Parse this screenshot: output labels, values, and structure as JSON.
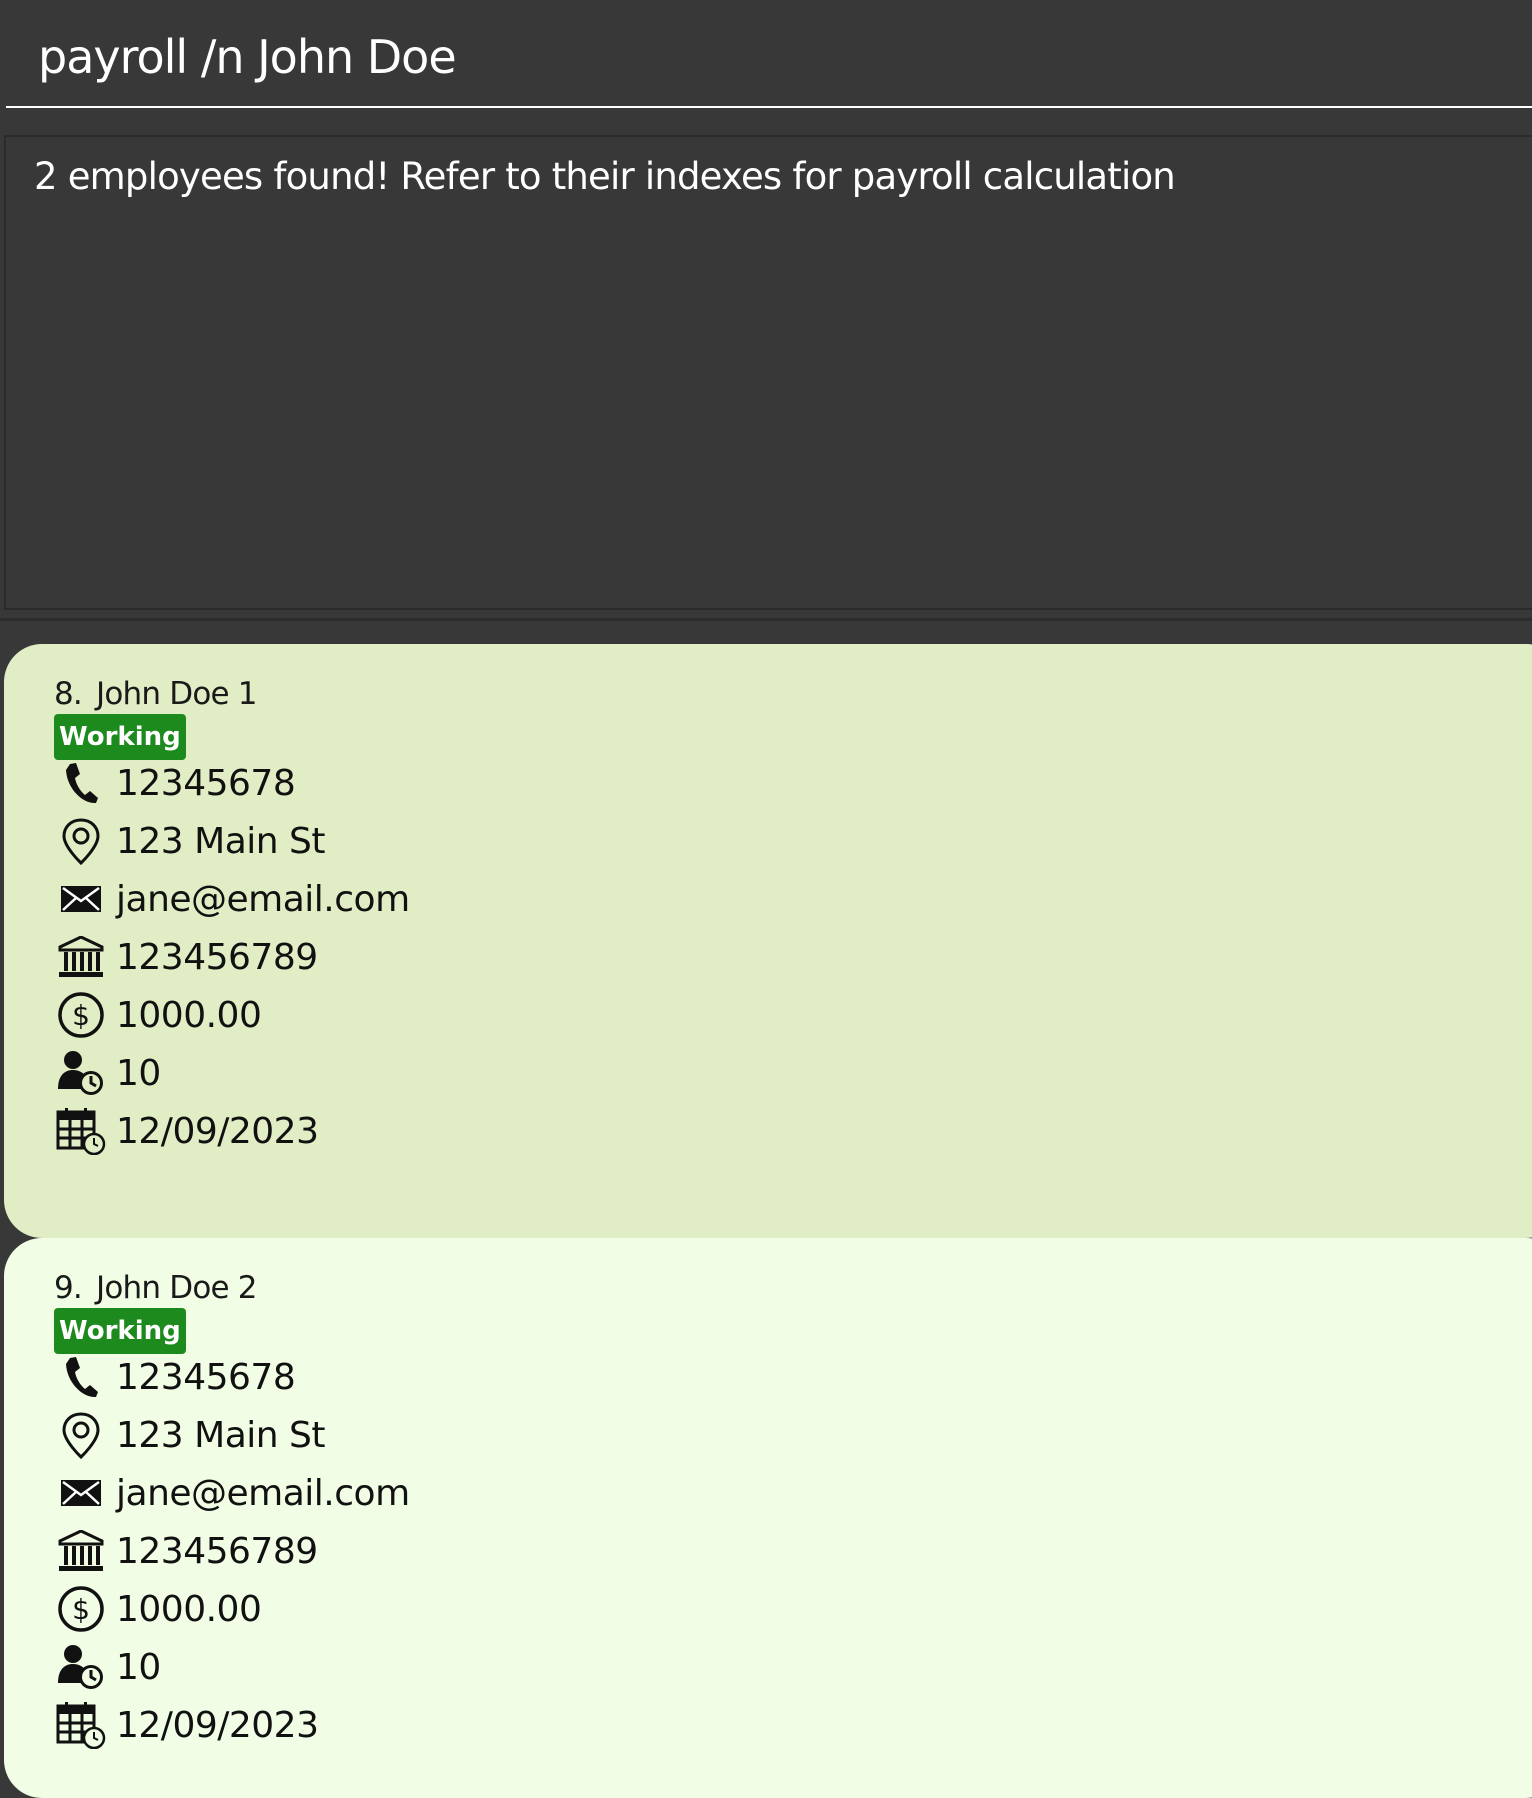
{
  "command": {
    "value": "payroll /n John Doe"
  },
  "result": {
    "message": "2 employees found! Refer to their indexes for payroll calculation"
  },
  "colors": {
    "background": "#383838",
    "card_selected": "#e1edc4",
    "card_default": "#f1fde4",
    "badge": "#1c8a1c"
  },
  "employees": [
    {
      "index": "8.",
      "name": "John Doe 1",
      "status": "Working",
      "phone": "12345678",
      "address": "123 Main St",
      "email": "jane@email.com",
      "bank_account": "123456789",
      "salary": "1000.00",
      "overtime": "10",
      "date": "12/09/2023"
    },
    {
      "index": "9.",
      "name": "John Doe 2",
      "status": "Working",
      "phone": "12345678",
      "address": "123 Main St",
      "email": "jane@email.com",
      "bank_account": "123456789",
      "salary": "1000.00",
      "overtime": "10",
      "date": "12/09/2023"
    }
  ],
  "icons": [
    "phone-icon",
    "location-pin-icon",
    "envelope-icon",
    "bank-icon",
    "dollar-icon",
    "person-clock-icon",
    "calendar-clock-icon"
  ]
}
